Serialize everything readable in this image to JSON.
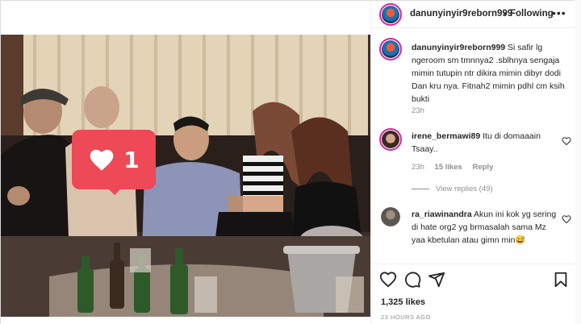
{
  "post": {
    "author": "danunyinyir9reborn999",
    "separator": "•",
    "follow_label": "Following",
    "more_label": "•••",
    "like_badge_count": "1",
    "likes": "1,325 likes",
    "timestamp": "23 HOURS AGO"
  },
  "caption": {
    "username": "danunyinyir9reborn999",
    "text": "Si safir lg ngeroom sm tmnnya2 .sblhnya sengaja mimin tutupin ntr dikira mimin dibyr dodi Dan kru nya. Fitnah2 mimin pdhl cm ksih bukti",
    "time": "23h"
  },
  "comments": [
    {
      "username": "irene_bermawi89",
      "text": "Itu di domaaain Tsaay..",
      "time": "23h",
      "likes": "15 likes",
      "reply_label": "Reply",
      "view_replies": "View replies (49)"
    },
    {
      "username": "ra_riawinandra",
      "text": "Akun ini kok yg sering di hate org2 yg brmasalah sama Mz yaa kbetulan atau gimn min😅"
    }
  ],
  "icons": {
    "like": "heart-icon",
    "comment": "comment-icon",
    "share": "share-icon",
    "save": "bookmark-icon"
  },
  "colors": {
    "like_badge": "#ed4956",
    "story_ring": "#d6249f",
    "muted_text": "#8e8e8e"
  }
}
